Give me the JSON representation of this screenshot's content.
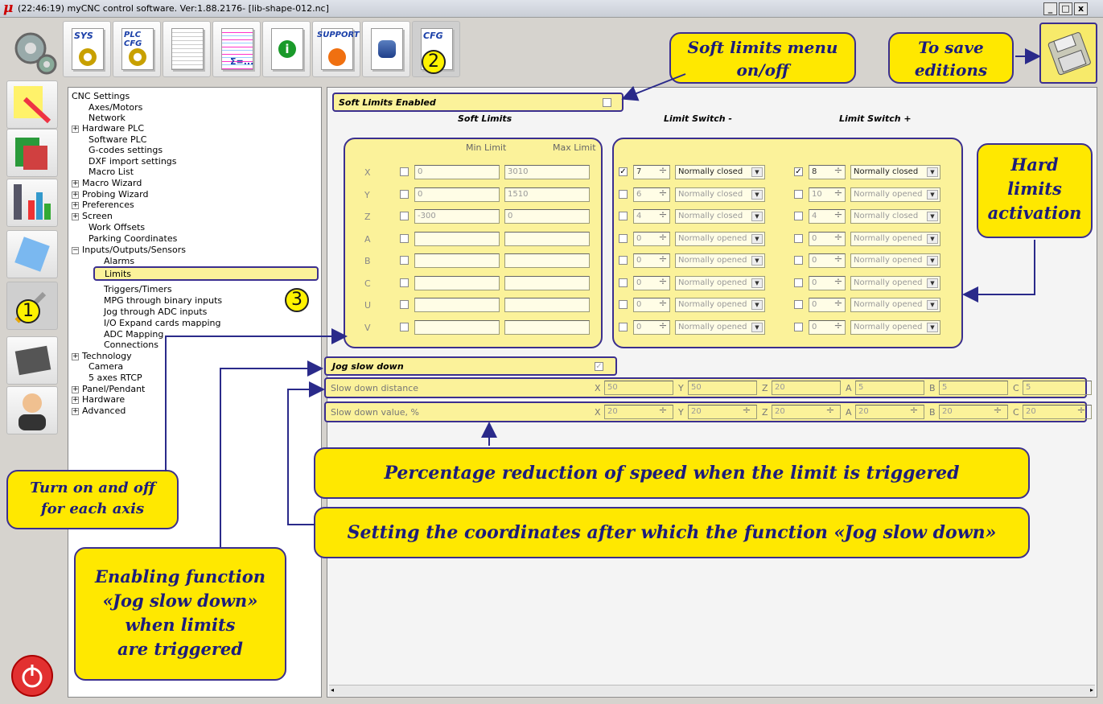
{
  "window": {
    "title": "(22:46:19)  myCNC control software. Ver:1.88.2176-   [lib-shape-012.nc]",
    "buttons": [
      "_",
      "□",
      "x"
    ]
  },
  "toolbar": {
    "sys": "SYS",
    "plc": "PLC\nCFG",
    "support": "SUPPORT",
    "cfg": "CFG",
    "sum": "Σ=..."
  },
  "badges": {
    "one": "1",
    "two": "2",
    "three": "3"
  },
  "tree": {
    "root": "CNC Settings",
    "items": [
      "Axes/Motors",
      "Network",
      "Hardware PLC",
      "Software PLC",
      "G-codes settings",
      "DXF import settings",
      "Macro List",
      "Macro Wizard",
      "Probing Wizard",
      "Preferences",
      "Screen",
      "Work Offsets",
      "Parking Coordinates",
      "Inputs/Outputs/Sensors"
    ],
    "sub_items": [
      "Alarms",
      "Limits",
      "Triggers/Timers",
      "MPG through binary inputs",
      "Jog through ADC inputs",
      "I/O Expand cards mapping",
      "ADC Mapping",
      "Connections"
    ],
    "after": [
      "Technology",
      "Camera",
      "5 axes RTCP",
      "Panel/Pendant",
      "Hardware",
      "Advanced"
    ]
  },
  "soft_limits": {
    "enabled_label": "Soft Limits Enabled",
    "col_soft": "Soft Limits",
    "col_minus": "Limit Switch -",
    "col_plus": "Limit Switch +",
    "min_label": "Min Limit",
    "max_label": "Max Limit"
  },
  "axes": [
    {
      "name": "X",
      "min": "0",
      "max": "3010",
      "sw_minus_on": true,
      "sw_minus": "7",
      "mode_minus": "Normally closed",
      "sw_plus_on": true,
      "sw_plus": "8",
      "mode_plus": "Normally closed"
    },
    {
      "name": "Y",
      "min": "0",
      "max": "1510",
      "sw_minus_on": false,
      "sw_minus": "6",
      "mode_minus": "Normally closed",
      "sw_plus_on": false,
      "sw_plus": "10",
      "mode_plus": "Normally opened"
    },
    {
      "name": "Z",
      "min": "-300",
      "max": "0",
      "sw_minus_on": false,
      "sw_minus": "4",
      "mode_minus": "Normally closed",
      "sw_plus_on": false,
      "sw_plus": "4",
      "mode_plus": "Normally closed"
    },
    {
      "name": "A",
      "min": "",
      "max": "",
      "sw_minus_on": false,
      "sw_minus": "0",
      "mode_minus": "Normally opened",
      "sw_plus_on": false,
      "sw_plus": "0",
      "mode_plus": "Normally opened"
    },
    {
      "name": "B",
      "min": "",
      "max": "",
      "sw_minus_on": false,
      "sw_minus": "0",
      "mode_minus": "Normally opened",
      "sw_plus_on": false,
      "sw_plus": "0",
      "mode_plus": "Normally opened"
    },
    {
      "name": "C",
      "min": "",
      "max": "",
      "sw_minus_on": false,
      "sw_minus": "0",
      "mode_minus": "Normally opened",
      "sw_plus_on": false,
      "sw_plus": "0",
      "mode_plus": "Normally opened"
    },
    {
      "name": "U",
      "min": "",
      "max": "",
      "sw_minus_on": false,
      "sw_minus": "0",
      "mode_minus": "Normally opened",
      "sw_plus_on": false,
      "sw_plus": "0",
      "mode_plus": "Normally opened"
    },
    {
      "name": "V",
      "min": "",
      "max": "",
      "sw_minus_on": false,
      "sw_minus": "0",
      "mode_minus": "Normally opened",
      "sw_plus_on": false,
      "sw_plus": "0",
      "mode_plus": "Normally opened"
    }
  ],
  "jog": {
    "label": "Jog slow down",
    "checked": true,
    "distance_label": "Slow down distance",
    "distance": [
      {
        "axis": "X",
        "v": "50"
      },
      {
        "axis": "Y",
        "v": "50"
      },
      {
        "axis": "Z",
        "v": "20"
      },
      {
        "axis": "A",
        "v": "5"
      },
      {
        "axis": "B",
        "v": "5"
      },
      {
        "axis": "C",
        "v": "5"
      }
    ],
    "value_label": "Slow down value, %",
    "value": [
      {
        "axis": "X",
        "v": "20"
      },
      {
        "axis": "Y",
        "v": "20"
      },
      {
        "axis": "Z",
        "v": "20"
      },
      {
        "axis": "A",
        "v": "20"
      },
      {
        "axis": "B",
        "v": "20"
      },
      {
        "axis": "C",
        "v": "20"
      }
    ]
  },
  "callouts": {
    "soft_menu": "Soft limits menu\non/off",
    "to_save": "To save\neditions",
    "hard_limits": "Hard\nlimits\nactivation",
    "percentage": "Percentage reduction of speed when the limit is triggered",
    "coords": "Setting the coordinates after which the function «Jog slow down»",
    "turn_on": "Turn on and off\nfor each axis",
    "enabling": "Enabling function\n«Jog slow down»\nwhen limits\nare triggered"
  },
  "colors": {
    "callout_fill": "#ffe800",
    "callout_border": "#3b2f8f",
    "callout_text": "#1c1c7c",
    "group_fill": "#fbf29a"
  }
}
